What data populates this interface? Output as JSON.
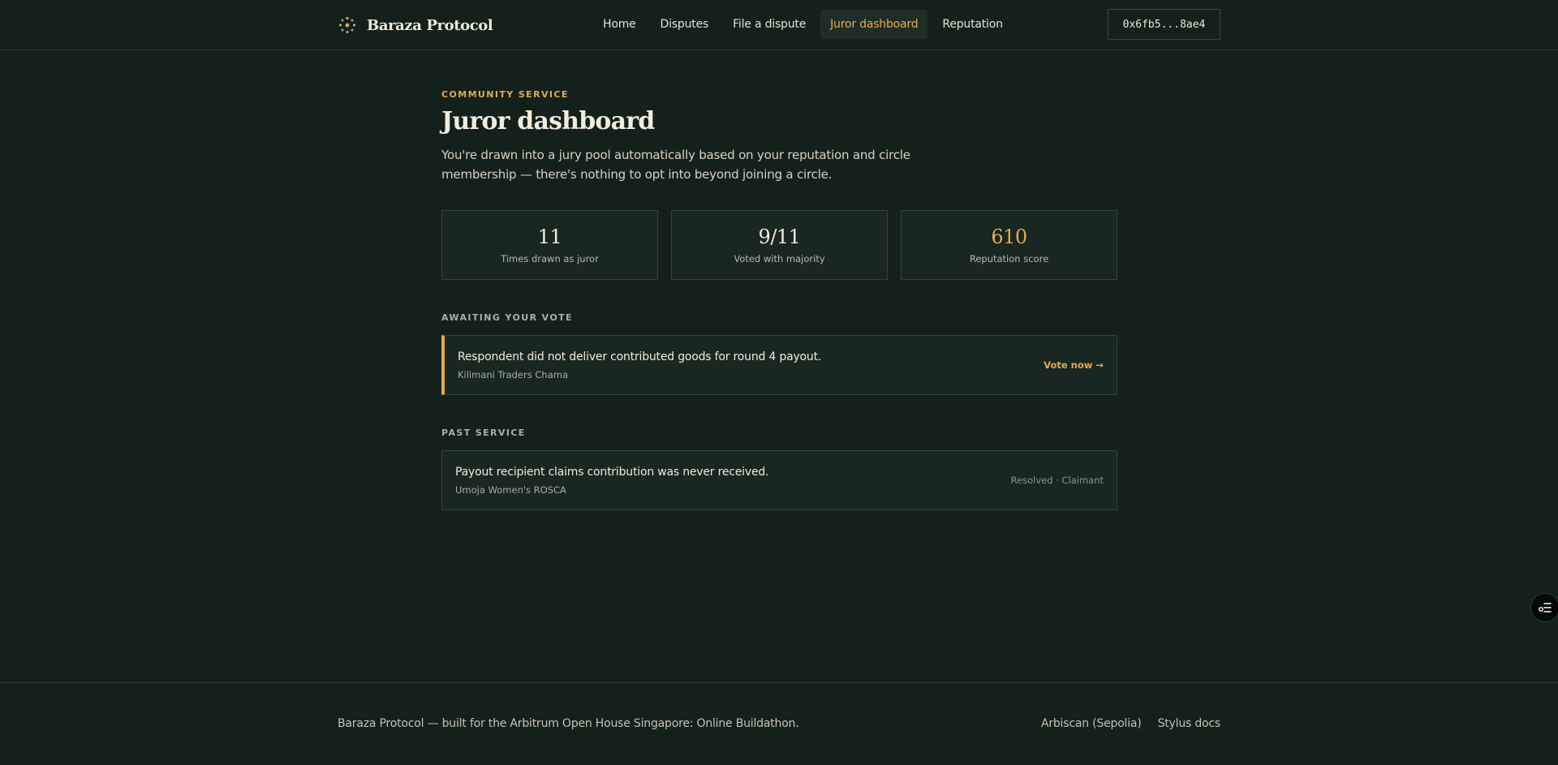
{
  "header": {
    "brand": "Baraza Protocol",
    "nav": [
      {
        "label": "Home"
      },
      {
        "label": "Disputes"
      },
      {
        "label": "File a dispute"
      },
      {
        "label": "Juror dashboard",
        "active": true
      },
      {
        "label": "Reputation"
      }
    ],
    "wallet": "0x6fb5...8ae4"
  },
  "page": {
    "eyebrow": "COMMUNITY SERVICE",
    "title": "Juror dashboard",
    "lede": "You're drawn into a jury pool automatically based on your reputation and circle membership — there's nothing to opt into beyond joining a circle."
  },
  "stats": [
    {
      "value": "11",
      "label": "Times drawn as juror"
    },
    {
      "value": "9/11",
      "label": "Voted with majority"
    },
    {
      "value": "610",
      "label": "Reputation score"
    }
  ],
  "awaiting": {
    "title": "AWAITING YOUR VOTE",
    "item": {
      "title": "Respondent did not deliver contributed goods for round 4 payout.",
      "circle": "Kilimani Traders Chama",
      "action": "Vote now →"
    }
  },
  "past": {
    "title": "PAST SERVICE",
    "item": {
      "title": "Payout recipient claims contribution was never received.",
      "circle": "Umoja Women's ROSCA",
      "status": "Resolved · Claimant"
    }
  },
  "footer": {
    "note": "Baraza Protocol — built for the Arbitrum Open House Singapore: Online Buildathon.",
    "links": [
      "Arbiscan (Sepolia)",
      "Stylus docs"
    ]
  },
  "colors": {
    "accent": "#e8a94a",
    "background": "#13201c",
    "card": "#182722"
  }
}
